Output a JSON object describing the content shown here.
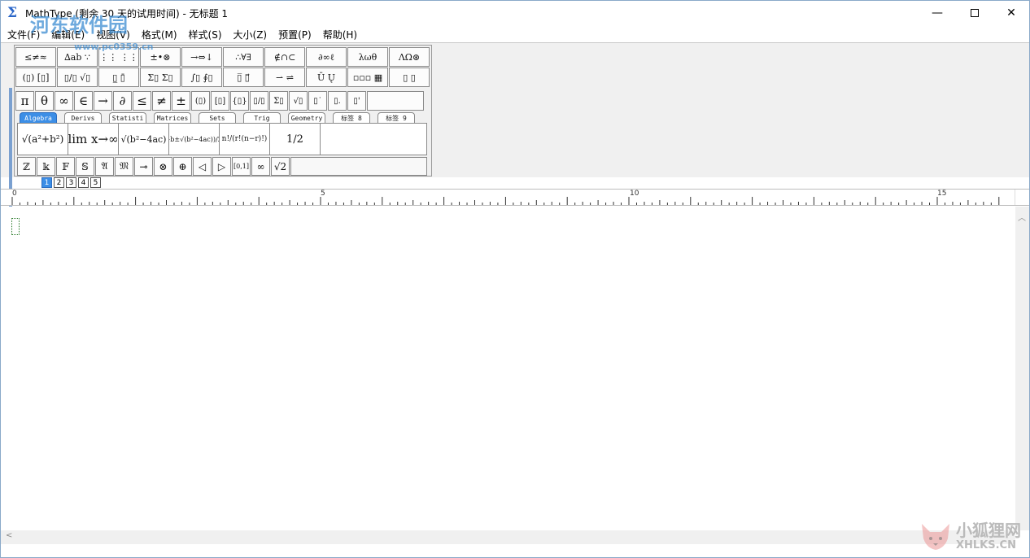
{
  "window": {
    "title": "MathType (剩余 30 天的试用时间) - 无标题 1",
    "minimize": "—",
    "close": "✕"
  },
  "menu": [
    "文件(F)",
    "编辑(E)",
    "视图(V)",
    "格式(M)",
    "样式(S)",
    "大小(Z)",
    "预置(P)",
    "帮助(H)"
  ],
  "watermark_top": {
    "name": "河东软件园",
    "url": "www.pc0359.cn"
  },
  "palettes_row1": [
    "≤≠≈",
    "∆ab ∵",
    "⋮⋮ ⋮⋮",
    "±•⊗",
    "→⇔↓",
    "∴∀∃",
    "∉∩⊂",
    "∂∞ℓ",
    "λωθ",
    "ΛΩ⊛"
  ],
  "palettes_row2": [
    "(▯) [▯]",
    "▯/▯ √▯",
    "▯̲ ▯̄",
    "Σ▯ Σ▯",
    "∫▯ ∮▯",
    "▯̅ ▯⃗",
    "⇀ ⇌",
    "Ū Ų",
    "▫▫▫ ▦",
    "▯ ▯"
  ],
  "symbols_row": [
    "π",
    "θ",
    "∞",
    "∈",
    "→",
    "∂",
    "≤",
    "≠",
    "±",
    "(▯)",
    "[▯]",
    "{▯}",
    "▯/▯",
    "Σ▯",
    "√▯",
    "▯˙",
    "▯.",
    "▯'"
  ],
  "tabs": [
    "Algebra",
    "Derivs",
    "Statisti",
    "Matrices",
    "Sets",
    "Trig",
    "Geometry",
    "标签 8",
    "标签 9"
  ],
  "templates": [
    "√(a²+b²)",
    "lim x→∞",
    "√(b²−4ac)",
    "(−b±√(b²−4ac))/2a",
    "n!/(r!(n−r)!)",
    "1/2"
  ],
  "bottom_row": [
    "ℤ",
    "𝕜",
    "𝔽",
    "𝕊",
    "𝔄",
    "𝔐",
    "⊸",
    "⊗",
    "⊕",
    "◁",
    "▷",
    "[0,1]",
    "∞",
    "√2"
  ],
  "size_buttons": [
    "1",
    "2",
    "3",
    "4",
    "5"
  ],
  "ruler_labels": [
    "0",
    "5",
    "10",
    "15"
  ],
  "watermark_bottom": {
    "name": "小狐狸网",
    "url": "XHLKS.CN"
  }
}
